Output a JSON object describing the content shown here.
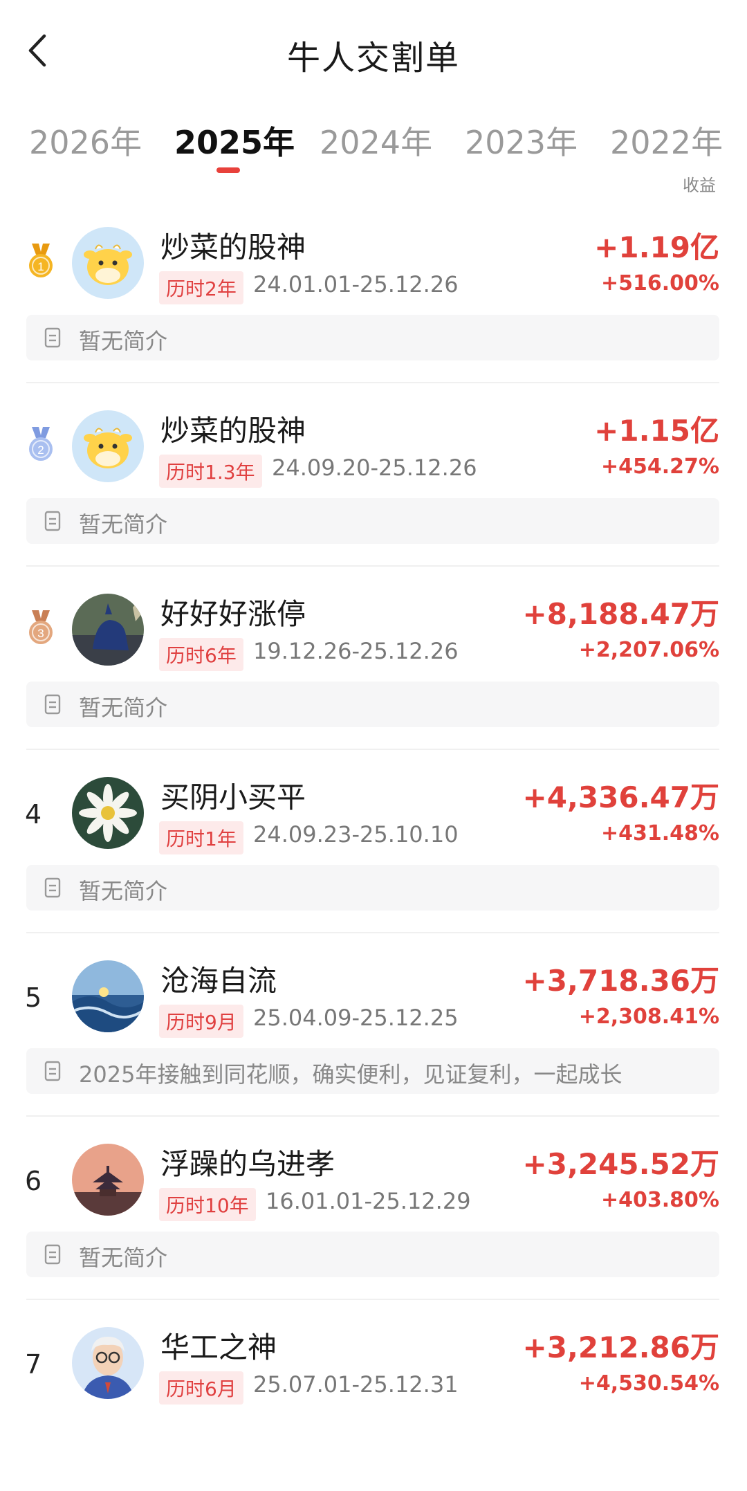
{
  "header": {
    "title": "牛人交割单"
  },
  "tabs": [
    {
      "label": "2026年"
    },
    {
      "label": "2025年"
    },
    {
      "label": "2024年"
    },
    {
      "label": "2023年"
    },
    {
      "label": "2022年"
    }
  ],
  "active_tab": 1,
  "sort_label": "收益",
  "accent_color": "#e0413b",
  "rows": [
    {
      "rank": "1",
      "medal": "gold",
      "name": "炒菜的股神",
      "duration": "历时2年",
      "range": "24.01.01-25.12.26",
      "amount": "+1.19亿",
      "pct": "+516.00%",
      "intro": "暂无简介",
      "avatar": "cow-avatar"
    },
    {
      "rank": "2",
      "medal": "silver",
      "name": "炒菜的股神",
      "duration": "历时1.3年",
      "range": "24.09.20-25.12.26",
      "amount": "+1.15亿",
      "pct": "+454.27%",
      "intro": "暂无简介",
      "avatar": "cow-avatar"
    },
    {
      "rank": "3",
      "medal": "bronze",
      "name": "好好好涨停",
      "duration": "历时6年",
      "range": "19.12.26-25.12.26",
      "amount": "+8,188.47万",
      "pct": "+2,207.06%",
      "intro": "暂无简介",
      "avatar": "bull-statue-avatar"
    },
    {
      "rank": "4",
      "medal": "",
      "name": "买阴小买平",
      "duration": "历时1年",
      "range": "24.09.23-25.10.10",
      "amount": "+4,336.47万",
      "pct": "+431.48%",
      "intro": "暂无简介",
      "avatar": "daisy-avatar"
    },
    {
      "rank": "5",
      "medal": "",
      "name": "沧海自流",
      "duration": "历时9月",
      "range": "25.04.09-25.12.25",
      "amount": "+3,718.36万",
      "pct": "+2,308.41%",
      "intro": "2025年接触到同花顺，确实便利，见证复利，一起成长",
      "avatar": "sea-avatar"
    },
    {
      "rank": "6",
      "medal": "",
      "name": "浮躁的乌进孝",
      "duration": "历时10年",
      "range": "16.01.01-25.12.29",
      "amount": "+3,245.52万",
      "pct": "+403.80%",
      "intro": "暂无简介",
      "avatar": "temple-avatar"
    },
    {
      "rank": "7",
      "medal": "",
      "name": "华工之神",
      "duration": "历时6月",
      "range": "25.07.01-25.12.31",
      "amount": "+3,212.86万",
      "pct": "+4,530.54%",
      "intro": "",
      "avatar": "cartoon-man-avatar"
    }
  ]
}
